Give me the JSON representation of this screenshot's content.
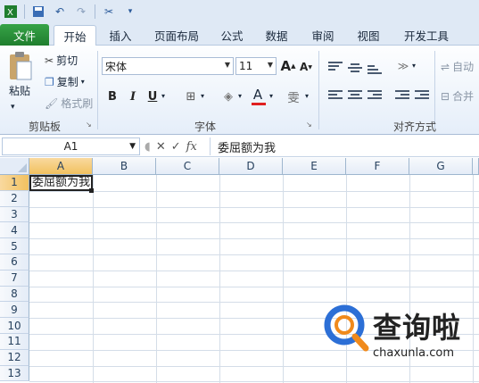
{
  "qat": {
    "icons": [
      "excel-logo-icon",
      "save-icon",
      "undo-icon",
      "redo-icon",
      "customize-icon"
    ]
  },
  "tabs": [
    "文件",
    "开始",
    "插入",
    "页面布局",
    "公式",
    "数据",
    "审阅",
    "视图",
    "开发工具"
  ],
  "clipboard": {
    "paste": "粘贴",
    "cut": "剪切",
    "copy": "复制",
    "format_painter": "格式刷",
    "label": "剪贴板"
  },
  "font": {
    "name": "宋体",
    "size": "11",
    "bold": "B",
    "italic": "I",
    "underline": "U",
    "grow": "A",
    "shrink": "A",
    "color_letter": "A",
    "phonetic": "雯",
    "label": "字体",
    "font_color": "#e02020"
  },
  "alignment": {
    "wrap": "自动",
    "merge": "合并",
    "label": "对齐方式"
  },
  "formula_bar": {
    "name_box": "A1",
    "cancel": "✕",
    "enter": "✓",
    "fx": "fx",
    "content": "委屈额为我"
  },
  "columns": [
    "A",
    "B",
    "C",
    "D",
    "E",
    "F",
    "G"
  ],
  "rows": [
    "1",
    "2",
    "3",
    "4",
    "5",
    "6",
    "7",
    "8",
    "9",
    "10",
    "11",
    "12",
    "13"
  ],
  "cell_a1": "委屈额为我",
  "watermark": {
    "title": "查询啦",
    "url": "chaxunla.com",
    "brand_color": "#2c6fd6",
    "accent_color": "#f08a1c"
  }
}
